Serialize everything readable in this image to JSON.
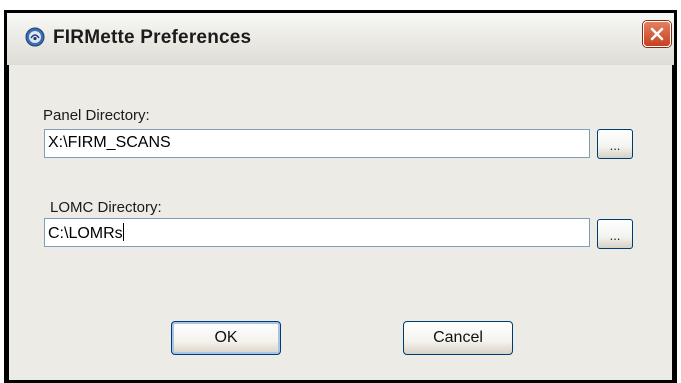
{
  "window": {
    "title": "FIRMette Preferences",
    "app_icon": "fema-seal-icon",
    "close_icon": "close-icon"
  },
  "panel_directory": {
    "label": "Panel Directory:",
    "value": "X:\\FIRM_SCANS",
    "browse_label": "..."
  },
  "lomc_directory": {
    "label": "LOMC Directory:",
    "value": "C:\\LOMRs",
    "browse_label": "..."
  },
  "buttons": {
    "ok_label": "OK",
    "cancel_label": "Cancel"
  },
  "colors": {
    "close_button": "#d8552f",
    "dialog_background": "#ecebe6",
    "input_border": "#7f9db9",
    "button_border": "#003c74"
  }
}
